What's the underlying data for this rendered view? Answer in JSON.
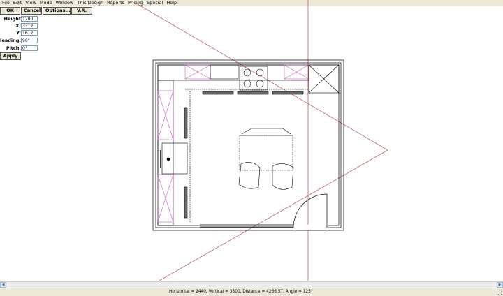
{
  "menu": [
    "File",
    "Edit",
    "View",
    "Mode",
    "Window",
    "This Design",
    "Reports",
    "Pricing",
    "Special",
    "Help"
  ],
  "toolbar": {
    "ok": "OK",
    "cancel": "Cancel",
    "options": "Options...",
    "vr": "V.R."
  },
  "camera": {
    "height": {
      "label": "Height",
      "value": "1200"
    },
    "x": {
      "label": "X:",
      "value": "3312"
    },
    "y": {
      "label": "Y:",
      "value": "1612"
    },
    "heading": {
      "label": "Heading:",
      "value": "90°"
    },
    "pitch": {
      "label": "Pitch:",
      "value": "0°"
    }
  },
  "apply_label": "Apply",
  "status": "Horizontal = 2440, Vertical = 3500, Distance = 4266.57, Angle = 125°",
  "colors": {
    "chrome": "#ece9d8",
    "view_line": "#c06060",
    "plan_line": "#000000",
    "cabinet_mark": "#c060c0"
  },
  "icons": {
    "scroll_left": "scroll-left-icon",
    "scroll_right": "scroll-right-icon"
  }
}
